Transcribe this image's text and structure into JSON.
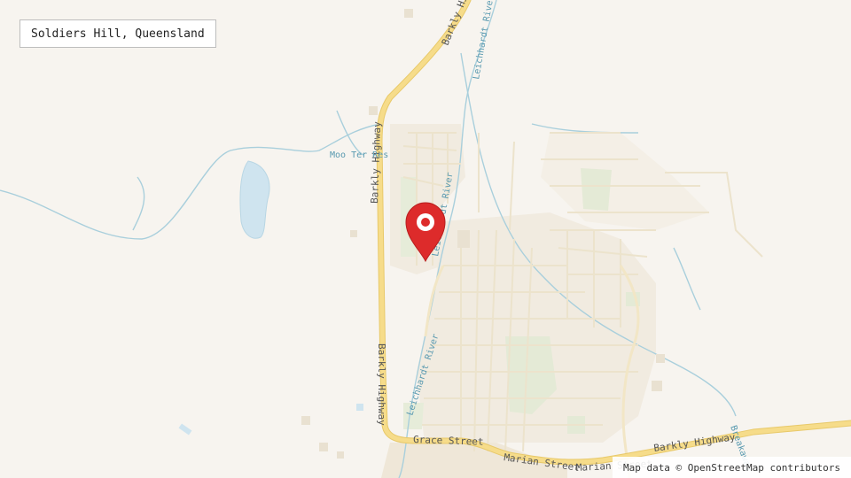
{
  "place": {
    "title": "Soldiers Hill, Queensland"
  },
  "attribution": "Map data © OpenStreetMap contributors",
  "marker": {
    "icon": "location-pin-icon",
    "color": "#dd2b2b"
  },
  "labels": {
    "barkly_highway_north": "Barkly Highway",
    "barkly_highway_west": "Barkly Highway",
    "barkly_highway_south": "Barkly Highway",
    "barkly_highway_east": "Barkly Highway",
    "grace_street": "Grace Street",
    "marian_street_1": "Marian Street",
    "marian_street_2": "Marian Street",
    "leichhardt_river_north": "Leichhardt River",
    "leichhardt_river_mid": "Leichhardt River",
    "leichhardt_river_south": "Leichhardt River",
    "reservoir": "Moo Ter Res",
    "breakaway": "Breakaway"
  },
  "colors": {
    "background": "#f7f4ef",
    "urban": "#f1ebe0",
    "park": "#e4ead6",
    "water": "#cfe4ef",
    "river": "#a9cfdc",
    "highway": "#f6dc8a",
    "minor_road": "#ece3cc"
  }
}
